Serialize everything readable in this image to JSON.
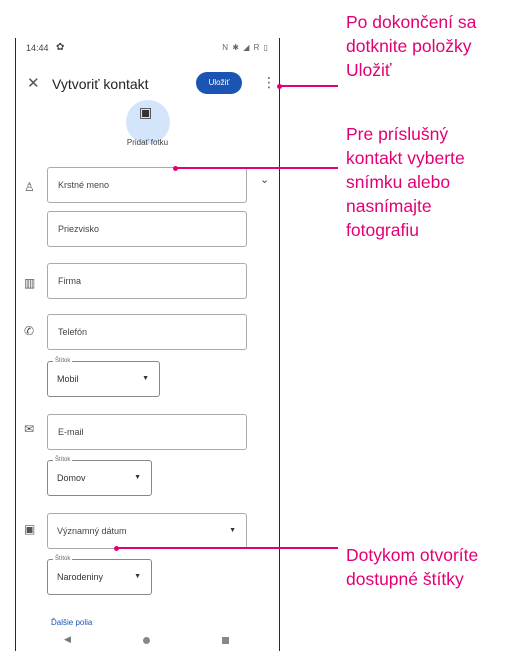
{
  "status_bar": {
    "time": "14:44",
    "settings_glyph": "✿",
    "indicators": "N ✱ ◢ R ▯"
  },
  "app_bar": {
    "close_glyph": "✕",
    "title": "Vytvoriť kontakt",
    "save_label": "Uložiť",
    "more_glyph": "⋮"
  },
  "photo": {
    "icon": "add-photo-icon",
    "glyph": "▣",
    "label": "Pridať fotku"
  },
  "icons": {
    "person": "person-icon",
    "business": "business-icon",
    "phone": "phone-icon",
    "email": "email-icon",
    "calendar": "calendar-icon",
    "chevron": "chevron-down-icon"
  },
  "icon_glyphs": {
    "person": "♙",
    "business": "▥",
    "phone": "✆",
    "email": "✉",
    "calendar": "▣",
    "chevron": "⌄",
    "caret": "▼"
  },
  "fields": {
    "first_name": "Krstné meno",
    "last_name": "Priezvisko",
    "company": "Firma",
    "phone": "Telefón",
    "email": "E-mail",
    "significant_date": "Významný dátum"
  },
  "selects": {
    "phone_label_legend": "Štítok",
    "phone_label_value": "Mobil",
    "email_label_legend": "Štítok",
    "email_label_value": "Domov",
    "date_label_legend": "Štítok",
    "date_label_value": "Narodeniny"
  },
  "more_fields": "Ďalšie polia",
  "nav": {
    "back": "◀"
  },
  "callouts": {
    "save": "Po dokončení sa dotknite položky Uložiť",
    "photo": "Pre príslušný kontakt vyberte snímku alebo nasnímajte fotografiu",
    "labels": "Dotykom otvoríte dostupné štítky"
  },
  "colors": {
    "accent": "#e20074",
    "save_button": "#1a55b3",
    "photo_circle": "#d4e4fb"
  }
}
